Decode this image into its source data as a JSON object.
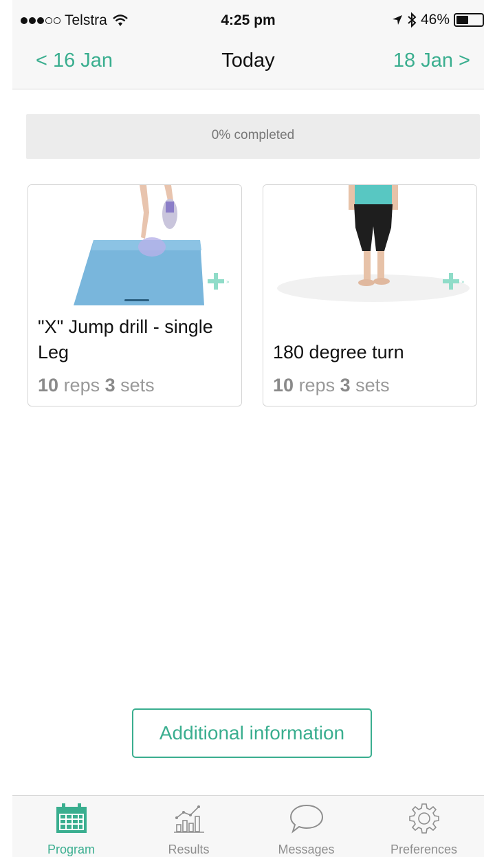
{
  "status_bar": {
    "carrier": "Telstra",
    "time": "4:25 pm",
    "battery": "46%",
    "battery_level": 0.46
  },
  "nav": {
    "prev": "< 16 Jan",
    "title": "Today",
    "next": "18 Jan >"
  },
  "progress": {
    "label": "0% completed",
    "value": 0
  },
  "exercises": [
    {
      "title": "\"X\" Jump drill - single Leg",
      "reps": "10",
      "reps_label": "reps",
      "sets": "3",
      "sets_label": "sets"
    },
    {
      "title": "180 degree turn",
      "reps": "10",
      "reps_label": "reps",
      "sets": "3",
      "sets_label": "sets"
    }
  ],
  "additional_info_label": "Additional information",
  "tabs": [
    {
      "label": "Program",
      "icon": "calendar-icon",
      "active": true
    },
    {
      "label": "Results",
      "icon": "chart-icon",
      "active": false
    },
    {
      "label": "Messages",
      "icon": "speech-bubble-icon",
      "active": false
    },
    {
      "label": "Preferences",
      "icon": "gear-icon",
      "active": false
    }
  ],
  "colors": {
    "accent": "#3aae8f",
    "bar_background": "#f7f7f7",
    "muted_text": "#999999"
  }
}
